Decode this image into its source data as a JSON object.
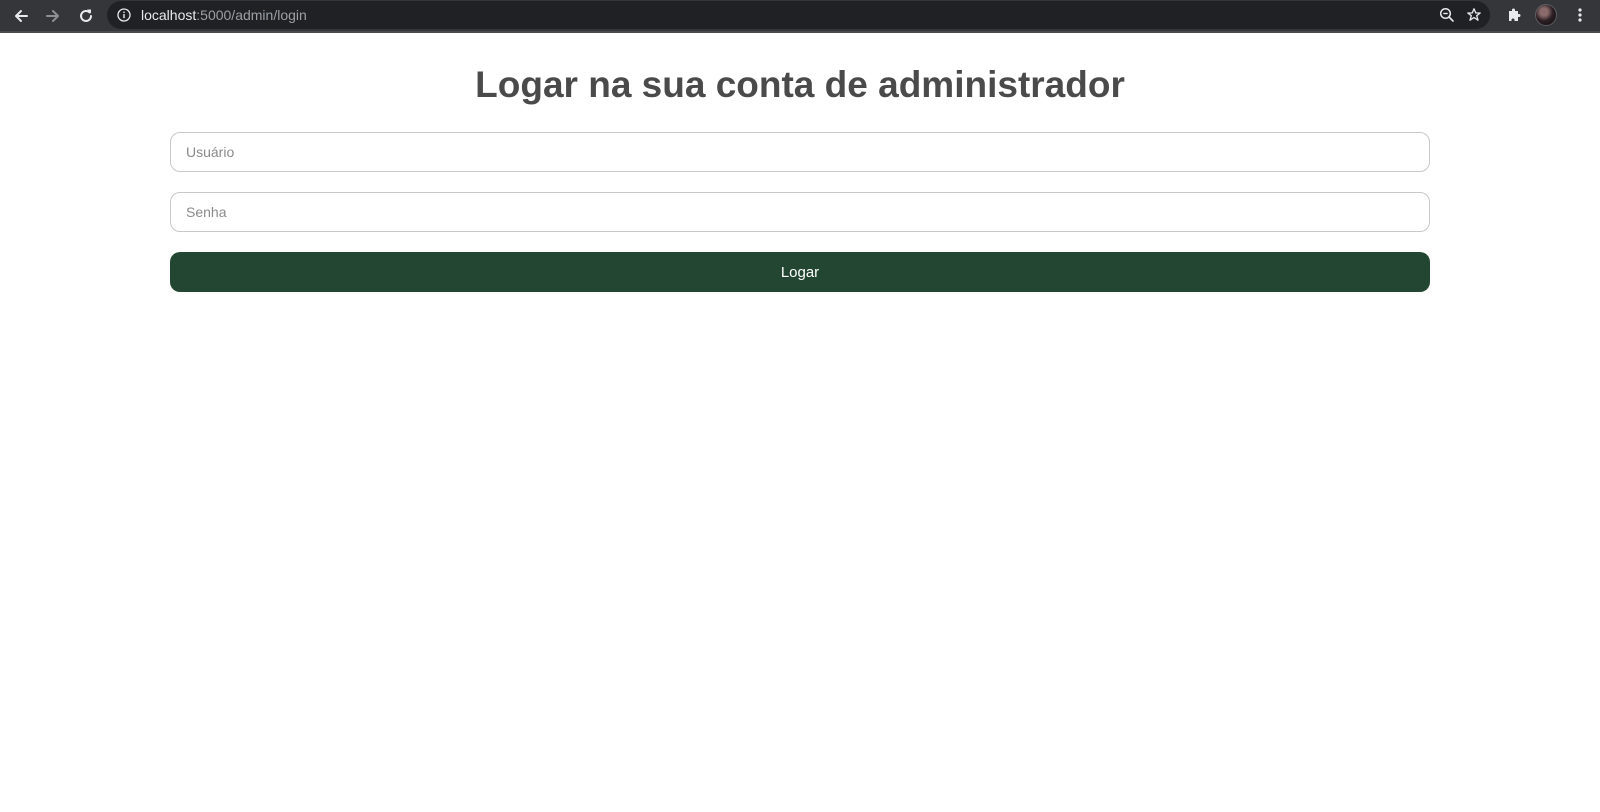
{
  "browser": {
    "url_host": "localhost",
    "url_path": ":5000/admin/login",
    "icons": {
      "back": "arrow-left-icon",
      "forward": "arrow-right-icon",
      "reload": "reload-icon",
      "site_info": "info-icon",
      "zoom": "zoom-out-icon",
      "bookmark": "star-icon",
      "extensions": "puzzle-icon",
      "profile": "avatar",
      "menu": "kebab-menu-icon"
    }
  },
  "page": {
    "title": "Logar na sua conta de administrador"
  },
  "form": {
    "username_placeholder": "Usuário",
    "password_placeholder": "Senha",
    "submit_label": "Logar"
  },
  "colors": {
    "title": "#4a4a4a",
    "button": "#234632",
    "button_text": "#ffffff",
    "field_border": "#c9c9c9",
    "chrome_bar": "#35363a",
    "omnibox": "#202124"
  }
}
